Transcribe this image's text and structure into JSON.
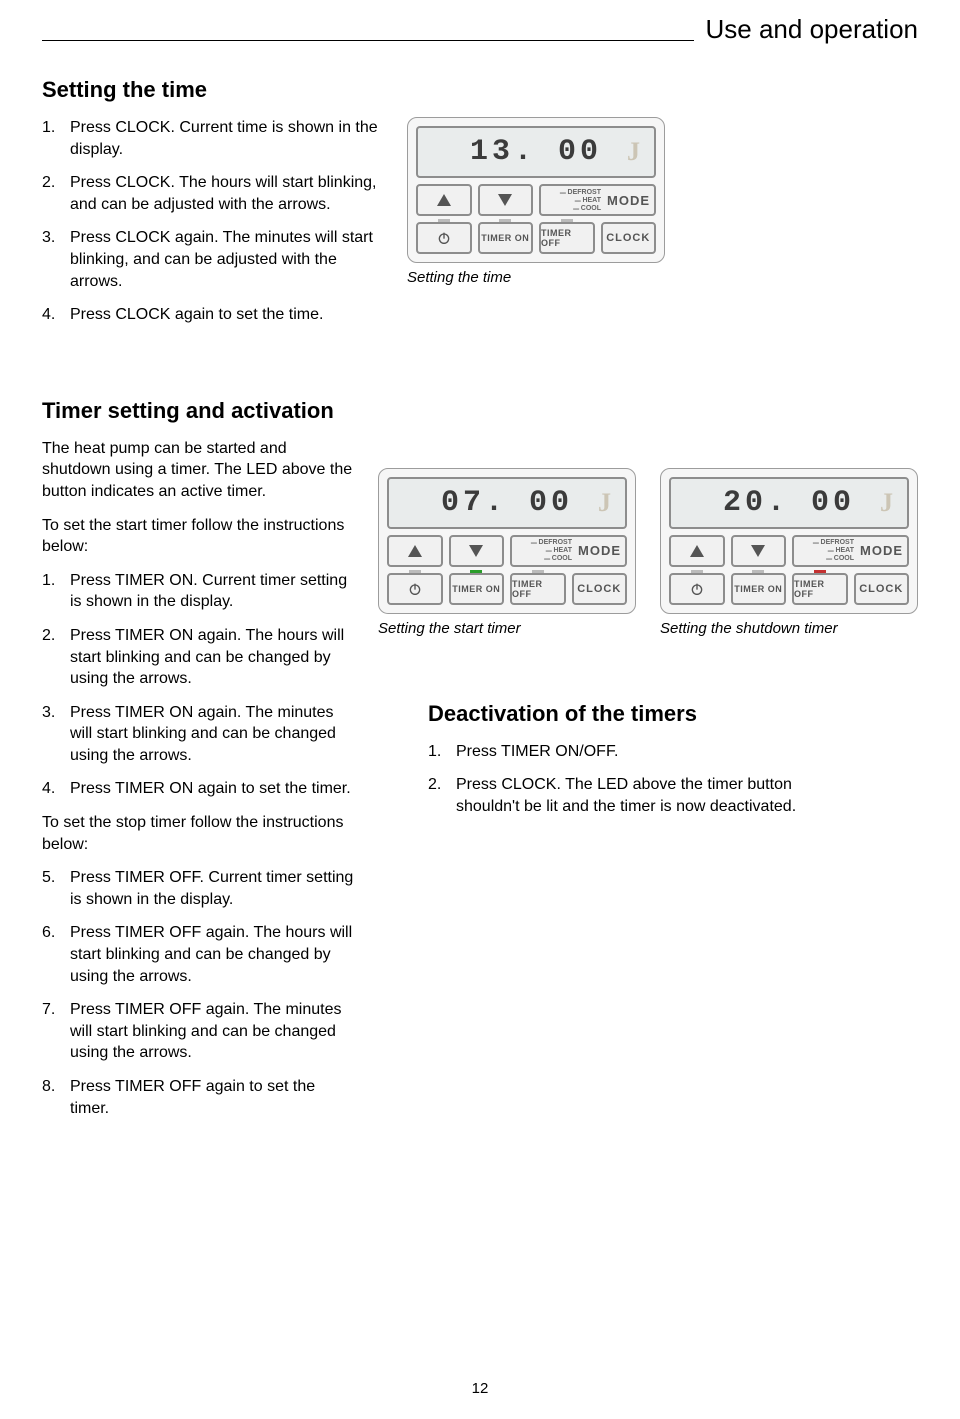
{
  "header": {
    "title": "Use and operation"
  },
  "section1": {
    "heading": "Setting the time",
    "steps": [
      "Press CLOCK. Current time is shown in the display.",
      "Press CLOCK. The hours will start blinking, and can be adjusted with the arrows.",
      "Press CLOCK again. The minutes will start blinking, and can be adjusted with the arrows.",
      "Press CLOCK again to set the time."
    ],
    "fig_caption": "Setting the time"
  },
  "section2": {
    "heading": "Timer setting and activation",
    "intro": "The heat pump can be started and shutdown using a timer. The LED above the button indicates an active timer.",
    "start_intro": "To set the start timer follow the instructions below:",
    "steps_start": [
      "Press TIMER ON. Current timer setting is shown in the display.",
      "Press TIMER ON again. The hours will start blinking and can be changed by using the arrows.",
      "Press TIMER ON again. The minutes will start blinking and can be changed using the arrows.",
      "Press TIMER ON again to set the timer."
    ],
    "stop_intro": "To set the stop timer follow the instructions below:",
    "steps_stop": [
      "Press TIMER OFF. Current timer setting is shown in the display.",
      "Press TIMER OFF again. The hours will start blinking and can be changed by using the arrows.",
      "Press TIMER OFF again. The minutes will start blinking and can be changed using the arrows.",
      "Press TIMER OFF again to set the timer."
    ],
    "fig1_caption": "Setting the start timer",
    "fig2_caption": "Setting the shutdown timer"
  },
  "deactivation": {
    "heading": "Deactivation of the timers",
    "steps": [
      "Press TIMER ON/OFF.",
      "Press CLOCK. The LED above the timer button shouldn't be lit and the timer is now deactivated."
    ]
  },
  "panel": {
    "display1": "13. 00",
    "display2": "07. 00",
    "display3": "20. 00",
    "logo": "J",
    "mode_labels": {
      "defrost": "DEFROST",
      "heat": "HEAT",
      "cool": "COOL",
      "mode": "MODE"
    },
    "btn_timer_on": "TIMER ON",
    "btn_timer_off": "TIMER OFF",
    "btn_clock": "CLOCK"
  },
  "page_number": "12"
}
